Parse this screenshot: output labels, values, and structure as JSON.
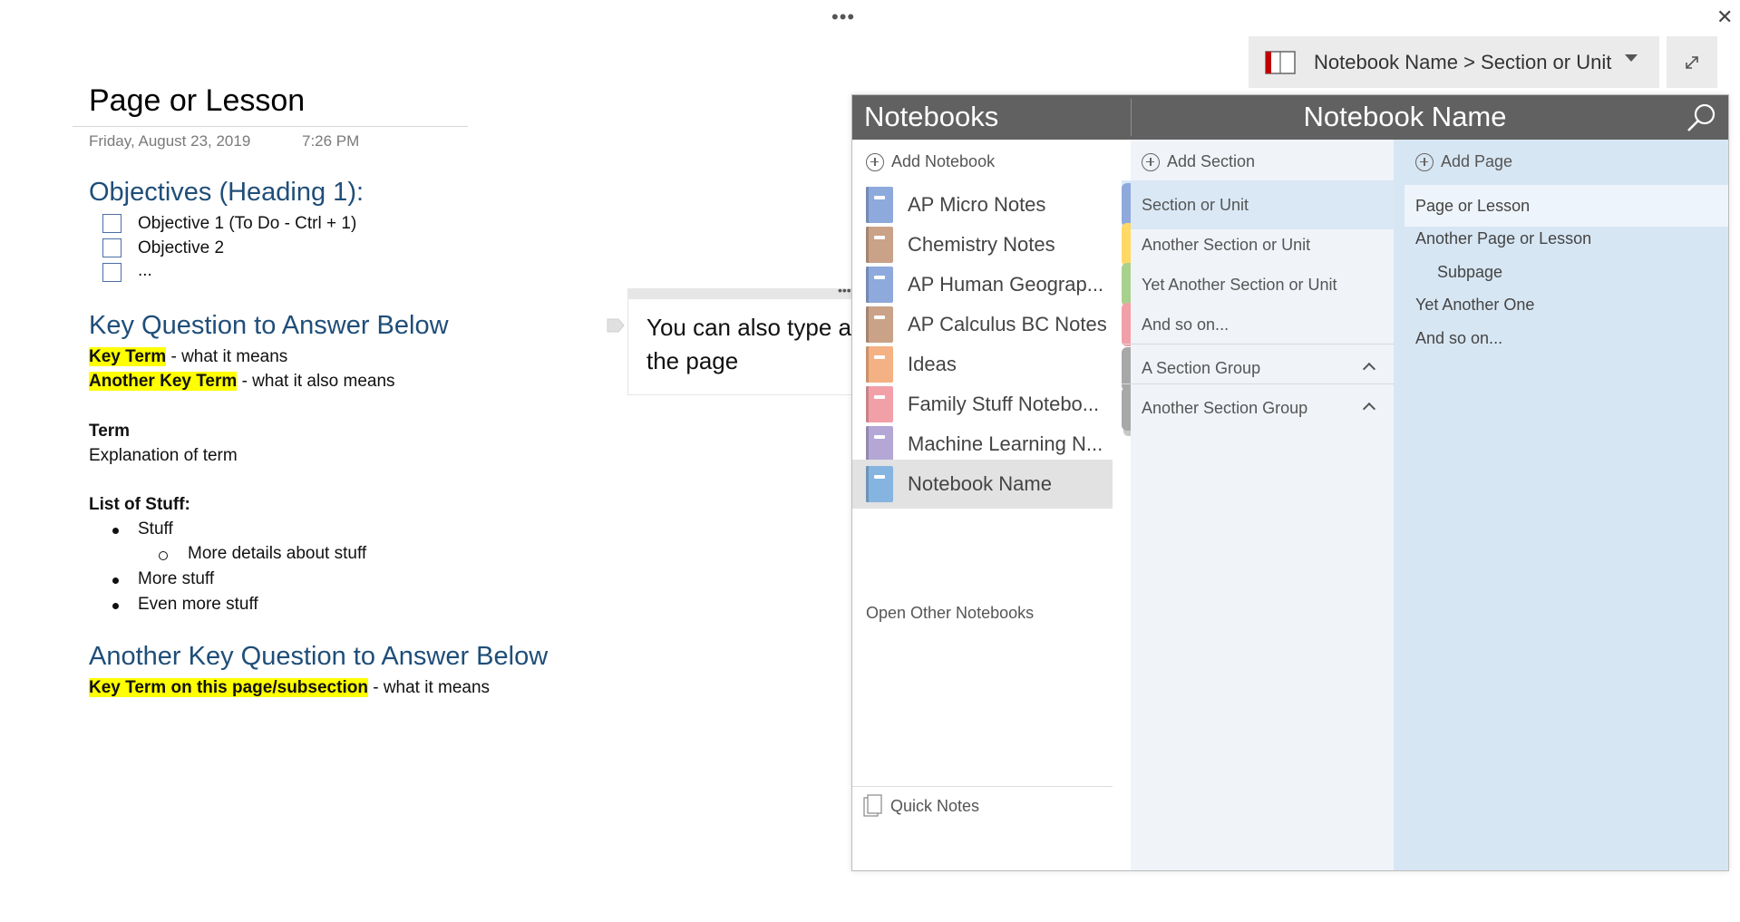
{
  "window": {
    "dots": "•••",
    "close": "✕"
  },
  "navigator": {
    "breadcrumb": "Notebook Name > Section or Unit"
  },
  "page": {
    "title": "Page or Lesson",
    "date": "Friday, August 23, 2019",
    "time": "7:26 PM",
    "objectives_heading": "Objectives (Heading 1):",
    "objectives": [
      "Objective 1 (To Do - Ctrl + 1)",
      "Objective 2",
      "..."
    ],
    "key_question_heading": "Key Question to Answer Below",
    "key_term_1": "Key Term",
    "key_term_1_def": " - what it means",
    "key_term_2": "Another Key Term",
    "key_term_2_def": " - what it also means",
    "term_label": "Term",
    "term_explanation": "Explanation of term",
    "list_label": "List of Stuff:",
    "list_items": [
      "Stuff",
      "More details about stuff",
      "More stuff",
      "Even more stuff"
    ],
    "key_question_2_heading": "Another Key Question to Answer Below",
    "key_term_3": "Key Term on this page/subsection",
    "key_term_3_def": " - what it means",
    "note_line_1": "You can also type a",
    "note_line_2": "the page"
  },
  "panel": {
    "notebooks_title": "Notebooks",
    "current_notebook": "Notebook Name",
    "add_notebook": "Add Notebook",
    "add_section": "Add Section",
    "add_page": "Add Page",
    "notebooks": [
      {
        "label": "AP Micro Notes",
        "color": "#8ea9db"
      },
      {
        "label": "Chemistry Notes",
        "color": "#c9a288"
      },
      {
        "label": "AP Human Geograp...",
        "color": "#8ea9db"
      },
      {
        "label": "AP Calculus BC Notes",
        "color": "#c9a288"
      },
      {
        "label": "Ideas",
        "color": "#f4b183"
      },
      {
        "label": "Family Stuff Notebo...",
        "color": "#f2a0a8"
      },
      {
        "label": "Machine Learning N...",
        "color": "#b4a7d6"
      },
      {
        "label": "Notebook Name",
        "color": "#86b4e0"
      }
    ],
    "open_other": "Open Other Notebooks",
    "quick_notes": "Quick Notes",
    "sections": [
      {
        "label": "Section or Unit",
        "color": "#8ea9db"
      },
      {
        "label": "Another Section or Unit",
        "color": "#ffd966"
      },
      {
        "label": "Yet Another Section or Unit",
        "color": "#a9d18e"
      },
      {
        "label": "And so on...",
        "color": "#f2a0a8"
      }
    ],
    "section_groups": [
      "A Section Group",
      "Another Section Group"
    ],
    "pages": [
      "Page or Lesson",
      "Another Page or Lesson",
      "Subpage",
      "Yet Another One",
      "And so on..."
    ]
  }
}
